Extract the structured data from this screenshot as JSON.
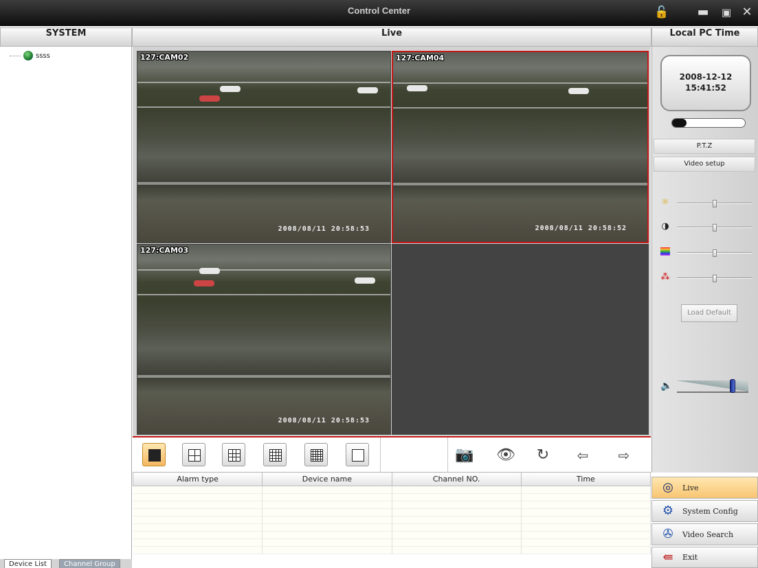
{
  "window": {
    "title": "Control Center"
  },
  "headers": {
    "system": "SYSTEM",
    "live": "Live",
    "local_time": "Local PC Time"
  },
  "tree": {
    "device": "ssss"
  },
  "bottom_tabs": [
    "Device List",
    "Channel Group"
  ],
  "cameras": [
    {
      "label": "127:CAM02",
      "timestamp": "2008/08/11  20:58:53",
      "active": false
    },
    {
      "label": "127:CAM04",
      "timestamp": "2008/08/11  20:58:52",
      "active": true
    },
    {
      "label": "127:CAM03",
      "timestamp": "2008/08/11  20:58:53",
      "active": false
    }
  ],
  "clock": {
    "date": "2008-12-12",
    "time": "15:41:52",
    "progress": 0.2
  },
  "right_buttons": {
    "ptz": "P.T.Z",
    "video_setup": "Video setup",
    "load_default": "Load Default"
  },
  "sliders": [
    {
      "icon": "brightness-icon",
      "value": 0.5
    },
    {
      "icon": "contrast-icon",
      "value": 0.5
    },
    {
      "icon": "hue-icon",
      "value": 0.5
    },
    {
      "icon": "saturation-icon",
      "value": 0.5
    }
  ],
  "volume": {
    "icon": "speaker-icon",
    "value": 0.8
  },
  "alarm_table": {
    "columns": [
      "Alarm type",
      "Device name",
      "Channel NO.",
      "Time"
    ],
    "rows": 9
  },
  "nav": [
    {
      "label": "Live",
      "icon": "live-eye-icon",
      "selected": true
    },
    {
      "label": "System Config",
      "icon": "gear-icon",
      "selected": false
    },
    {
      "label": "Video Search",
      "icon": "film-reel-icon",
      "selected": false
    },
    {
      "label": "Exit",
      "icon": "exit-door-icon",
      "selected": false
    }
  ],
  "colors": {
    "active_border": "#c41818",
    "selected_nav": "#f7c572"
  }
}
